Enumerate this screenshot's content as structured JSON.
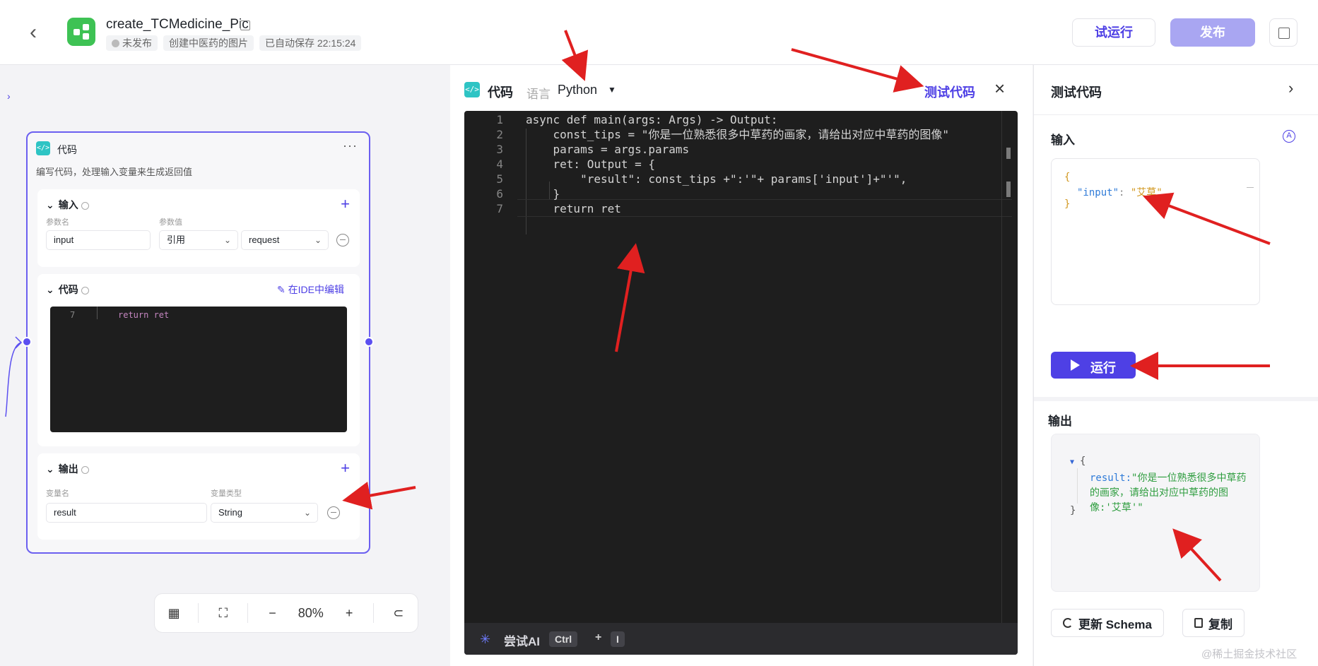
{
  "header": {
    "title": "create_TCMedicine_Pic",
    "status": "未发布",
    "description": "创建中医药的图片",
    "autosave": "已自动保存 22:15:24",
    "trial_run_label": "试运行",
    "publish_label": "发布"
  },
  "node": {
    "title": "代码",
    "more": "···",
    "description": "编写代码，处理输入变量来生成返回值",
    "input_section": {
      "title": "输入",
      "param_name_label": "参数名",
      "param_value_label": "参数值",
      "param_name": "input",
      "ref_mode": "引用",
      "ref_value": "request"
    },
    "code_section": {
      "title": "代码",
      "edit_in_ide": "在IDE中编辑",
      "preview_line_number": "7",
      "preview_line": "return ret"
    },
    "output_section": {
      "title": "输出",
      "var_name_label": "变量名",
      "var_type_label": "变量类型",
      "var_name": "result",
      "var_type": "String"
    }
  },
  "zoom": {
    "level": "80%"
  },
  "code_panel": {
    "title": "代码",
    "language_label": "语言",
    "language": "Python",
    "test_code_label": "测试代码",
    "lines": [
      {
        "n": "1",
        "text": "async def main(args: Args) -> Output:"
      },
      {
        "n": "2",
        "text": "    const_tips = \"你是一位熟悉很多中草药的画家，请给出对应中草药的图像\""
      },
      {
        "n": "3",
        "text": "    params = args.params"
      },
      {
        "n": "4",
        "text": "    ret: Output = {"
      },
      {
        "n": "5",
        "text": "        \"result\": const_tips +\":'\"+ params['input']+\"'\","
      },
      {
        "n": "6",
        "text": "    }"
      },
      {
        "n": "7",
        "text": "    return ret"
      }
    ],
    "ai_label": "尝试AI",
    "shortcut_key1": "Ctrl",
    "shortcut_plus": "+",
    "shortcut_key2": "I"
  },
  "test_panel": {
    "title": "测试代码",
    "input_label": "输入",
    "input_json_key": "\"input\"",
    "input_json_value": "\"艾草\"",
    "run_label": "运行",
    "output_label": "输出",
    "output_key": "result:",
    "output_value": "\"你是一位熟悉很多中草药的画家，请给出对应中草药的图像:'艾草'\"",
    "update_schema_label": "更新 Schema",
    "copy_label": "复制"
  },
  "watermark": "@稀土掘金技术社区",
  "colors": {
    "accent": "#4e40e5",
    "publish_disabled": "#a9a6f2",
    "app_icon": "#3ec254",
    "annotation_arrow": "#e02020"
  }
}
